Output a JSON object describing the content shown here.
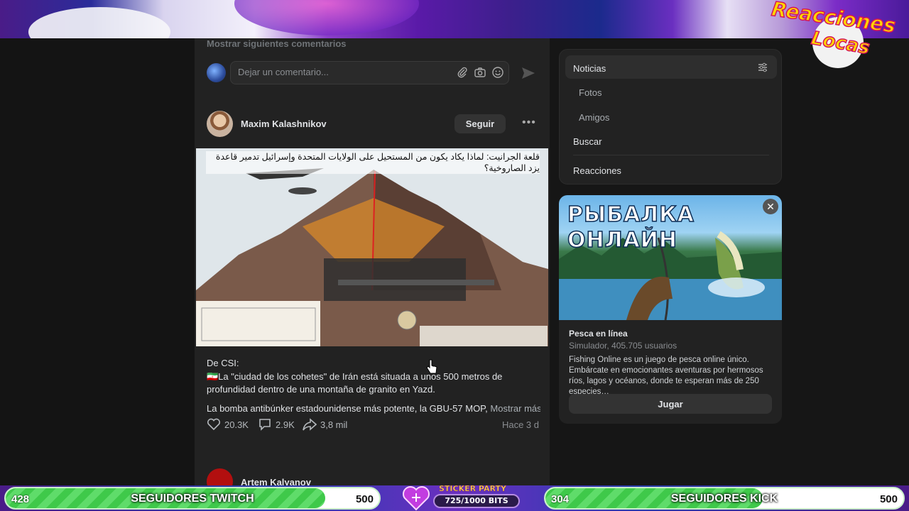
{
  "stream_overlay": {
    "logo_line1": "Reacciones",
    "logo_line2": "Locas",
    "twitch": {
      "current": "428",
      "label": "SEGUIDORES TWITCH",
      "goal": "500",
      "progress": 0.856
    },
    "sticker": {
      "label": "STICKER PARTY",
      "bits": "725/1000 BITS",
      "progress": 0.725
    },
    "kick": {
      "current": "304",
      "label": "SEGUIDORES KICK",
      "goal": "500",
      "progress": 0.608
    }
  },
  "feed": {
    "show_more_comments": "Mostrar siguientes comentarios",
    "comment_placeholder": "Dejar un comentario...",
    "post": {
      "author": "Maxim Kalashnikov",
      "follow_label": "Seguir",
      "image_title_ar": "قلعة الجرانيت: لماذا يكاد يكون من المستحيل على الولايات المتحدة وإسرائيل تدمير قاعدة يزد الصاروخية؟",
      "text_line1": "De CSI:",
      "text_line2": "🇮🇷La \"ciudad de los cohetes\" de Irán está situada a unos 500 metros de profundidad dentro de una montaña de granito en Yazd.",
      "text_line3": "La bomba antibúnker estadounidense más potente, la GBU-57 MOP, ",
      "show_more": "Mostrar más",
      "likes": "20.3K",
      "comments": "2.9K",
      "shares": "3,8 mil",
      "time": "Hace 3 d"
    },
    "next_post_author": "Artem Kalyanov"
  },
  "right_menu": {
    "items": [
      {
        "label": "Noticias"
      },
      {
        "label": "Fotos"
      },
      {
        "label": "Amigos"
      },
      {
        "label": "Buscar"
      },
      {
        "label": "Reacciones"
      }
    ]
  },
  "ad": {
    "image_text": "РЫБАЛКА ОНЛАЙН",
    "title": "Pesca en línea",
    "subtitle": "Simulador, 405.705 usuarios",
    "description": "Fishing Online es un juego de pesca online único. Embárcate en emocionantes aventuras por hermosos ríos, lagos y océanos, donde te esperan más de 250 especies…",
    "button": "Jugar"
  },
  "colors": {
    "accent_green": "#3fc94a",
    "panel": "#222222",
    "background": "#141414"
  }
}
